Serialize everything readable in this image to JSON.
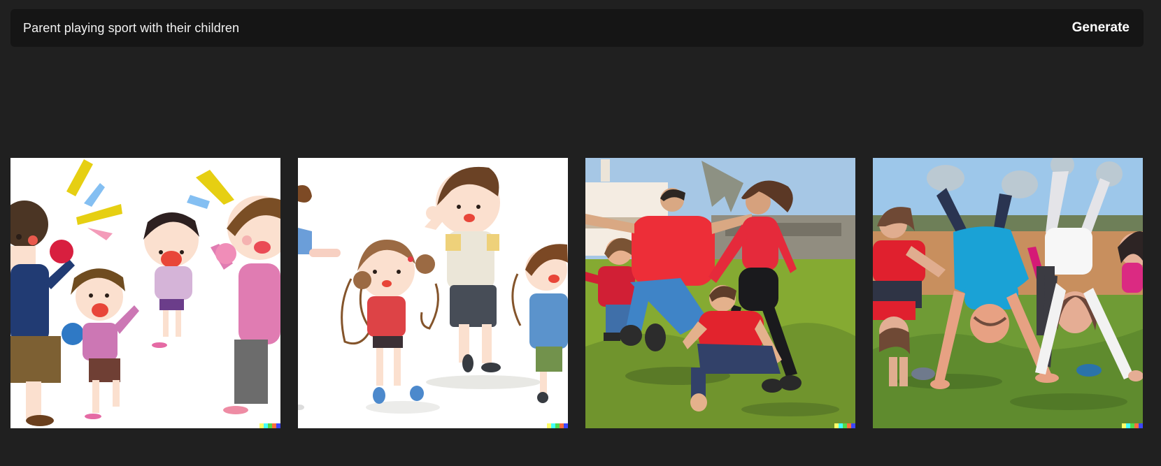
{
  "prompt": {
    "text": "Parent playing sport with their children",
    "generate_label": "Generate"
  },
  "results": [
    {
      "name": "cartoon ball game illustration"
    },
    {
      "name": "cartoon jump rope illustration"
    },
    {
      "name": "family jumping on grass photo"
    },
    {
      "name": "family handstand on grass photo"
    }
  ],
  "colors": {
    "page_bg": "#202020",
    "prompt_bg": "#151515",
    "text": "#f2f2f2",
    "signature": [
      "#ffff66",
      "#42ffff",
      "#51da4c",
      "#ff6e3c",
      "#3c46ff"
    ]
  }
}
